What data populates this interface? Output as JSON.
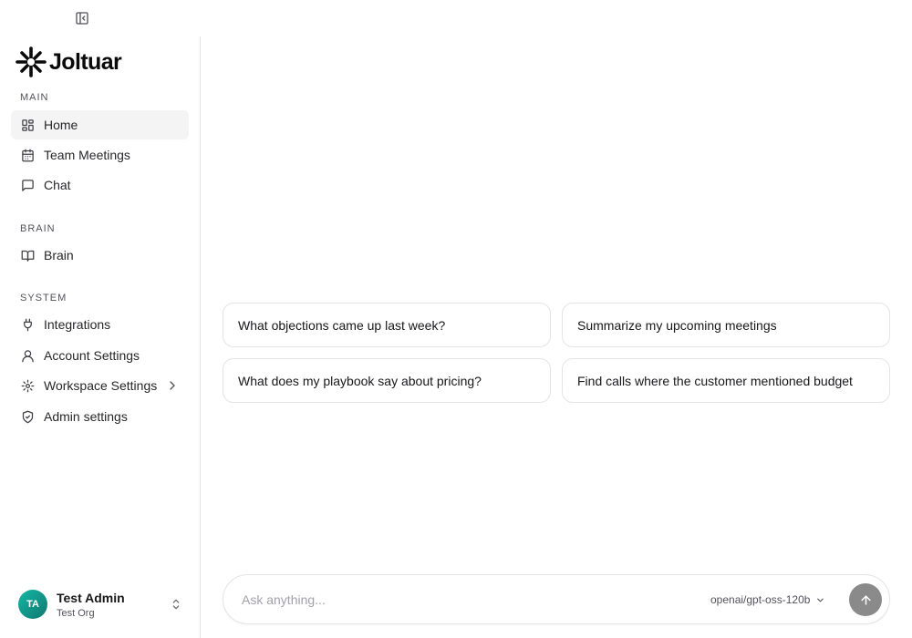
{
  "app": {
    "logo_text": "Joltuar"
  },
  "icons": {
    "collapse": "panel-left-icon",
    "home": "layout-grid-icon",
    "meetings": "calendar-icon",
    "chat": "message-square-icon",
    "brain": "book-open-icon",
    "integrations": "plug-icon",
    "account": "user-icon",
    "workspace": "gear-icon",
    "admin": "shield-check-icon",
    "send": "arrow-up-icon"
  },
  "sidebar": {
    "sections": [
      {
        "label": "MAIN"
      },
      {
        "label": "BRAIN"
      },
      {
        "label": "SYSTEM"
      }
    ],
    "items": [
      {
        "label": "Home",
        "active": true
      },
      {
        "label": "Team Meetings"
      },
      {
        "label": "Chat"
      },
      {
        "label": "Brain"
      },
      {
        "label": "Integrations"
      },
      {
        "label": "Account Settings"
      },
      {
        "label": "Workspace Settings",
        "has_submenu": true
      },
      {
        "label": "Admin settings"
      }
    ],
    "user": {
      "initials": "TA",
      "name": "Test Admin",
      "org": "Test Org"
    }
  },
  "suggestions": [
    "What objections came up last week?",
    "Summarize my upcoming meetings",
    "What does my playbook say about pricing?",
    "Find calls where the customer mentioned budget"
  ],
  "composer": {
    "placeholder": "Ask anything...",
    "value": "",
    "model": "openai/gpt-oss-120b"
  },
  "colors": {
    "active_bg": "#f4f4f5",
    "border": "#e4e4e7",
    "avatar": "#14b8a6",
    "send_button": "#8a8a8a"
  }
}
